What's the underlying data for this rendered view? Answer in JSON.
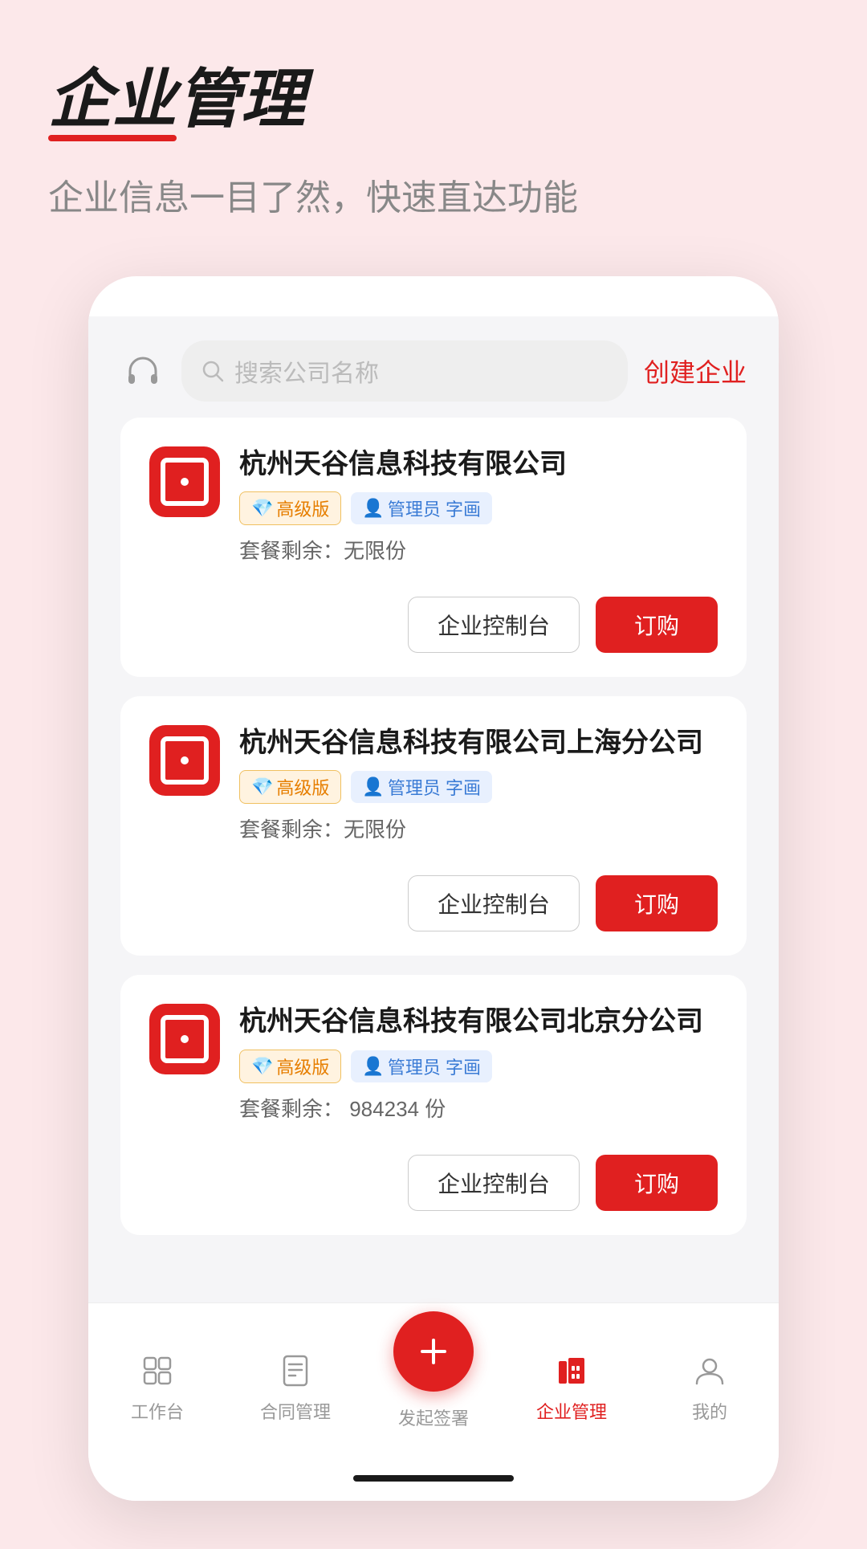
{
  "header": {
    "title": "企业管理",
    "subtitle": "企业信息一目了然，快速直达功能"
  },
  "search": {
    "placeholder": "搜索公司名称",
    "create_label": "创建企业"
  },
  "companies": [
    {
      "id": 1,
      "name": "杭州天谷信息科技有限公司",
      "vip_badge": "高级版",
      "role": "管理员 字画",
      "package_label": "套餐剩余：无限份",
      "btn_control": "企业控制台",
      "btn_order": "订购"
    },
    {
      "id": 2,
      "name": "杭州天谷信息科技有限公司上海分公司",
      "vip_badge": "高级版",
      "role": "管理员 字画",
      "package_label": "套餐剩余：无限份",
      "btn_control": "企业控制台",
      "btn_order": "订购"
    },
    {
      "id": 3,
      "name": "杭州天谷信息科技有限公司北京分公司",
      "vip_badge": "高级版",
      "role": "管理员 字画",
      "package_label": "套餐剩余：  984234 份",
      "btn_control": "企业控制台",
      "btn_order": "订购"
    }
  ],
  "nav": {
    "items": [
      {
        "id": "workbench",
        "label": "工作台",
        "active": false
      },
      {
        "id": "contracts",
        "label": "合同管理",
        "active": false
      },
      {
        "id": "sign",
        "label": "发起签署",
        "active": false,
        "is_fab": true
      },
      {
        "id": "enterprise",
        "label": "企业管理",
        "active": true
      },
      {
        "id": "mine",
        "label": "我的",
        "active": false
      }
    ]
  }
}
